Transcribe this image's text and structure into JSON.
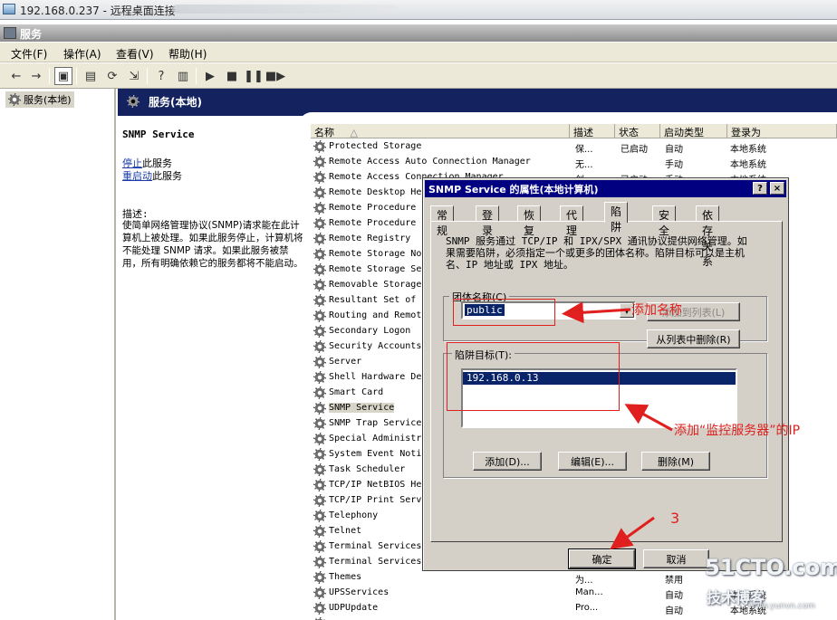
{
  "remote_title": "192.168.0.237 - 远程桌面连接",
  "window_title": "服务",
  "menu": [
    "文件(F)",
    "操作(A)",
    "查看(V)",
    "帮助(H)"
  ],
  "tree": {
    "root_label": "服务(本地)"
  },
  "header": {
    "title": "服务(本地)"
  },
  "description": {
    "service_name": "SNMP Service",
    "stop_link": "停止",
    "stop_rest": "此服务",
    "restart_link": "重启动",
    "restart_rest": "此服务",
    "label": "描述:",
    "text": "使简单网络管理协议(SNMP)请求能在此计算机上被处理。如果此服务停止，计算机将不能处理 SNMP 请求。如果此服务被禁用，所有明确依赖它的服务都将不能启动。"
  },
  "list": {
    "columns": [
      "名称",
      "描述",
      "状态",
      "启动类型",
      "登录为"
    ],
    "rows": [
      {
        "name": "Protected Storage",
        "desc": "保...",
        "status": "已启动",
        "startup": "自动",
        "logon": "本地系统"
      },
      {
        "name": "Remote Access Auto Connection Manager",
        "desc": "无...",
        "status": "",
        "startup": "手动",
        "logon": "本地系统"
      },
      {
        "name": "Remote Access Connection Manager",
        "desc": "创...",
        "status": "已启动",
        "startup": "手动",
        "logon": "本地系统"
      },
      {
        "name": "Remote Desktop He",
        "desc": "",
        "status": "",
        "startup": "",
        "logon": ""
      },
      {
        "name": "Remote Procedure",
        "desc": "",
        "status": "",
        "startup": "",
        "logon": ""
      },
      {
        "name": "Remote Procedure",
        "desc": "",
        "status": "",
        "startup": "",
        "logon": ""
      },
      {
        "name": "Remote Registry",
        "desc": "",
        "status": "",
        "startup": "",
        "logon": ""
      },
      {
        "name": "Remote Storage No",
        "desc": "",
        "status": "",
        "startup": "",
        "logon": ""
      },
      {
        "name": "Remote Storage Se",
        "desc": "",
        "status": "",
        "startup": "",
        "logon": ""
      },
      {
        "name": "Removable Storage",
        "desc": "",
        "status": "",
        "startup": "",
        "logon": ""
      },
      {
        "name": "Resultant Set of",
        "desc": "",
        "status": "",
        "startup": "",
        "logon": ""
      },
      {
        "name": "Routing and Remot",
        "desc": "",
        "status": "",
        "startup": "",
        "logon": ""
      },
      {
        "name": "Secondary Logon",
        "desc": "",
        "status": "",
        "startup": "",
        "logon": ""
      },
      {
        "name": "Security Accounts",
        "desc": "",
        "status": "",
        "startup": "",
        "logon": ""
      },
      {
        "name": "Server",
        "desc": "",
        "status": "",
        "startup": "",
        "logon": ""
      },
      {
        "name": "Shell Hardware De",
        "desc": "",
        "status": "",
        "startup": "",
        "logon": ""
      },
      {
        "name": "Smart Card",
        "desc": "",
        "status": "",
        "startup": "",
        "logon": ""
      },
      {
        "name": "SNMP Service",
        "desc": "",
        "status": "",
        "startup": "",
        "logon": ""
      },
      {
        "name": "SNMP Trap Service",
        "desc": "",
        "status": "",
        "startup": "",
        "logon": ""
      },
      {
        "name": "Special Administr",
        "desc": "",
        "status": "",
        "startup": "",
        "logon": ""
      },
      {
        "name": "System Event Noti",
        "desc": "",
        "status": "",
        "startup": "",
        "logon": ""
      },
      {
        "name": "Task Scheduler",
        "desc": "",
        "status": "",
        "startup": "",
        "logon": ""
      },
      {
        "name": "TCP/IP NetBIOS He",
        "desc": "",
        "status": "",
        "startup": "",
        "logon": ""
      },
      {
        "name": "TCP/IP Print Serv",
        "desc": "",
        "status": "",
        "startup": "",
        "logon": ""
      },
      {
        "name": "Telephony",
        "desc": "",
        "status": "",
        "startup": "",
        "logon": ""
      },
      {
        "name": "Telnet",
        "desc": "",
        "status": "",
        "startup": "",
        "logon": ""
      },
      {
        "name": "Terminal Services",
        "desc": "",
        "status": "",
        "startup": "",
        "logon": ""
      },
      {
        "name": "Terminal Services",
        "desc": "",
        "status": "",
        "startup": "",
        "logon": ""
      },
      {
        "name": "Themes",
        "desc": "为...",
        "status": "",
        "startup": "禁用",
        "logon": ""
      },
      {
        "name": "UPSServices",
        "desc": "Man...",
        "status": "",
        "startup": "自动",
        "logon": "本地系统"
      },
      {
        "name": "UDPUpdate",
        "desc": "Pro...",
        "status": "",
        "startup": "自动",
        "logon": "本地系统"
      },
      {
        "name": "",
        "desc": "管...",
        "status": "",
        "startup": "",
        "logon": "本地系统"
      }
    ]
  },
  "dialog": {
    "title": "SNMP Service 的属性(本地计算机)",
    "help_btn": "?",
    "close_btn": "×",
    "tabs": [
      "常规",
      "登录",
      "恢复",
      "代理",
      "陷阱",
      "安全",
      "依存关系"
    ],
    "intro": "SNMP 服务通过 TCP/IP 和 IPX/SPX 通讯协议提供网络管理。如果需要陷阱，必须指定一个或更多的团体名称。陷阱目标可以是主机名、IP 地址或 IPX 地址。",
    "community_label": "团体名称(C)",
    "community_value": "public",
    "add_to_list": "添加到列表(L)",
    "remove_from_list": "从列表中删除(R)",
    "trap_label": "陷阱目标(T):",
    "trap_target": "192.168.0.13",
    "add_btn": "添加(D)...",
    "edit_btn": "编辑(E)...",
    "delete_btn": "删除(M)",
    "ok_btn": "确定",
    "cancel_btn": "取消"
  },
  "annotations": {
    "add_name": "添加名称",
    "add_ip": "添加“监控服务器”的IP",
    "step": "3"
  },
  "watermark": {
    "line1": "51CTO.com",
    "line2": "技术博客",
    "line3": "www.yunvn.com"
  },
  "colors": {
    "header_band": "#14235f",
    "dialog_caption": "#000080",
    "annotation": "#e0201e"
  }
}
